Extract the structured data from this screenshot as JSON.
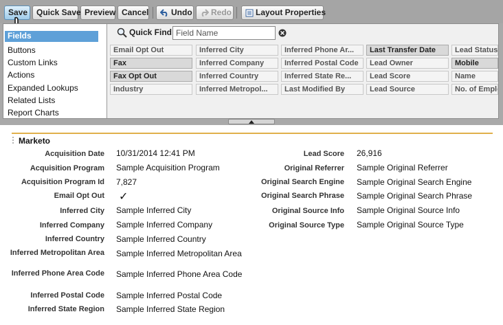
{
  "toolbar": {
    "save": "Save",
    "quick_save": "Quick Save",
    "preview": "Preview",
    "cancel": "Cancel",
    "undo": "Undo",
    "redo": "Redo",
    "layout_properties": "Layout Properties"
  },
  "palette": {
    "categories": [
      "Fields",
      "Buttons",
      "Custom Links",
      "Actions",
      "Expanded Lookups",
      "Related Lists",
      "Report Charts"
    ],
    "quick_find_label": "Quick Find",
    "quick_find_placeholder": "Field Name",
    "fields": [
      [
        "Email Opt Out",
        "Inferred City",
        "Inferred Phone Ar...",
        "Last Transfer Date",
        "Lead Status"
      ],
      [
        "Fax",
        "Inferred Company",
        "Inferred Postal Code",
        "Lead Owner",
        "Mobile"
      ],
      [
        "Fax Opt Out",
        "Inferred Country",
        "Inferred State Re...",
        "Lead Score",
        "Name"
      ],
      [
        "Industry",
        "Inferred Metropol...",
        "Last Modified By",
        "Lead Source",
        "No. of Emplo"
      ]
    ]
  },
  "section": {
    "title": "Marketo",
    "left": [
      {
        "label": "Acquisition Date",
        "value": "10/31/2014 12:41 PM"
      },
      {
        "label": "Acquisition Program",
        "value": "Sample Acquisition Program"
      },
      {
        "label": "Acquisition Program Id",
        "value": "7,827"
      },
      {
        "label": "Email Opt Out",
        "value": "✓"
      },
      {
        "label": "Inferred City",
        "value": "Sample Inferred City"
      },
      {
        "label": "Inferred Company",
        "value": "Sample Inferred Company"
      },
      {
        "label": "Inferred Country",
        "value": "Sample Inferred Country"
      },
      {
        "label": "Inferred Metropolitan Area",
        "value": "Sample Inferred Metropolitan Area"
      },
      {
        "label": "Inferred Phone Area Code",
        "value": "Sample Inferred Phone Area Code"
      },
      {
        "label": "Inferred Postal Code",
        "value": "Sample Inferred Postal Code"
      },
      {
        "label": "Inferred State Region",
        "value": "Sample Inferred State Region"
      }
    ],
    "right": [
      {
        "label": "Lead Score",
        "value": "26,916"
      },
      {
        "label": "Original Referrer",
        "value": "Sample Original Referrer"
      },
      {
        "label": "Original Search Engine",
        "value": "Sample Original Search Engine"
      },
      {
        "label": "Original Search Phrase",
        "value": "Sample Original Search Phrase"
      },
      {
        "label": "Original Source Info",
        "value": "Sample Original Source Info"
      },
      {
        "label": "Original Source Type",
        "value": "Sample Original Source Type"
      }
    ]
  }
}
